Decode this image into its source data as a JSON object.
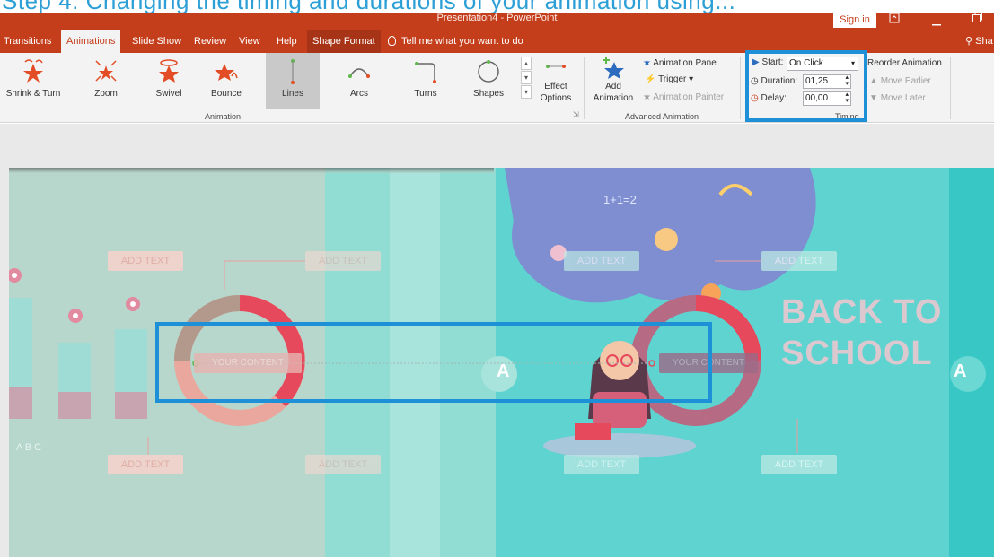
{
  "caption": "Step 4: Changing the timing and durations of your animation using...",
  "window": {
    "title": "Presentation4  -  PowerPoint",
    "sign_in": "Sign in"
  },
  "tabs": [
    {
      "label": "Transitions"
    },
    {
      "label": "Animations",
      "active": true
    },
    {
      "label": "Slide Show"
    },
    {
      "label": "Review"
    },
    {
      "label": "View"
    },
    {
      "label": "Help"
    },
    {
      "label": "Shape Format"
    }
  ],
  "tell_me": "Tell me what you want to do",
  "share": "Sha",
  "animation_gallery": [
    {
      "label": "Shrink & Turn",
      "icon": "shrink-turn-icon"
    },
    {
      "label": "Zoom",
      "icon": "zoom-icon"
    },
    {
      "label": "Swivel",
      "icon": "swivel-icon"
    },
    {
      "label": "Bounce",
      "icon": "bounce-icon"
    },
    {
      "label": "Lines",
      "icon": "lines-icon",
      "selected": true
    },
    {
      "label": "Arcs",
      "icon": "arcs-icon"
    },
    {
      "label": "Turns",
      "icon": "turns-icon"
    },
    {
      "label": "Shapes",
      "icon": "shapes-icon"
    }
  ],
  "effect_options": {
    "line1": "Effect",
    "line2": "Options"
  },
  "group_animation": "Animation",
  "advanced": {
    "add_line1": "Add",
    "add_line2": "Animation",
    "pane": "Animation Pane",
    "trigger": "Trigger",
    "painter": "Animation Painter",
    "group_label": "Advanced Animation"
  },
  "timing": {
    "start_label": "Start:",
    "start_value": "On Click",
    "duration_label": "Duration:",
    "duration_value": "01,25",
    "delay_label": "Delay:",
    "delay_value": "00,00",
    "reorder": "Reorder Animation",
    "move_earlier": "Move Earlier",
    "move_later": "Move Later",
    "group_label": "Timing"
  },
  "slide": {
    "add_text": "ADD TEXT",
    "back_to": "BACK TO",
    "school": "SCHOOL",
    "letter": "A",
    "your_content": "YOUR CONTENT",
    "legend": "A  B  C",
    "math": "1+1=2",
    "colors": {
      "accent_red": "#e6495b",
      "teal": "#5fd3d0",
      "highlight_blue": "#1e90d8"
    }
  }
}
